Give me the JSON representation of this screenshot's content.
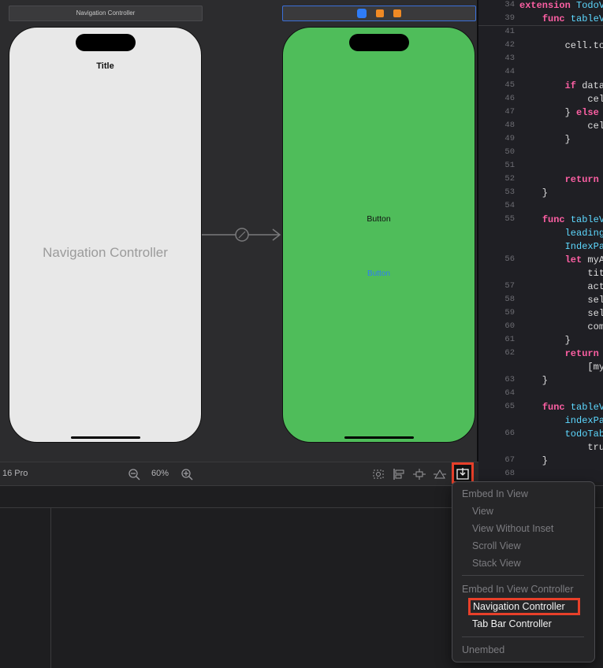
{
  "scenes": {
    "nav_scene_title": "Navigation Controller",
    "nav_phone_nav_title": "Title",
    "nav_phone_placeholder": "Navigation Controller",
    "second_phone_button_black": "Button",
    "second_phone_button_blue": "Button",
    "second_phone_bg": "#4fbd5a",
    "nav_phone_bg": "#e8e8e8"
  },
  "editor": {
    "lines": [
      {
        "n": "34",
        "text": "extension TodoV"
      },
      {
        "n": "39",
        "text": "    func tableV"
      },
      {
        "n": "41",
        "text": ""
      },
      {
        "n": "42",
        "text": "        cell.to"
      },
      {
        "n": "43",
        "text": ""
      },
      {
        "n": "44",
        "text": ""
      },
      {
        "n": "45",
        "text": "        if data"
      },
      {
        "n": "46",
        "text": "            cel"
      },
      {
        "n": "47",
        "text": "        } else"
      },
      {
        "n": "48",
        "text": "            cel"
      },
      {
        "n": "49",
        "text": "        }"
      },
      {
        "n": "50",
        "text": ""
      },
      {
        "n": "51",
        "text": ""
      },
      {
        "n": "52",
        "text": "        return"
      },
      {
        "n": "53",
        "text": "    }"
      },
      {
        "n": "54",
        "text": ""
      },
      {
        "n": "55",
        "text": "    func tableV"
      },
      {
        "n": "",
        "text": "        leading"
      },
      {
        "n": "",
        "text": "        IndexPa"
      },
      {
        "n": "56",
        "text": "        let myA"
      },
      {
        "n": "",
        "text": "            tit"
      },
      {
        "n": "57",
        "text": "            act"
      },
      {
        "n": "58",
        "text": "            sel"
      },
      {
        "n": "59",
        "text": "            sel"
      },
      {
        "n": "60",
        "text": "            com"
      },
      {
        "n": "61",
        "text": "        }"
      },
      {
        "n": "62",
        "text": "        return"
      },
      {
        "n": "",
        "text": "            [my"
      },
      {
        "n": "63",
        "text": "    }"
      },
      {
        "n": "64",
        "text": ""
      },
      {
        "n": "65",
        "text": "    func tableV"
      },
      {
        "n": "",
        "text": "        indexPa"
      },
      {
        "n": "66",
        "text": "        todoTab"
      },
      {
        "n": "",
        "text": "            tru"
      },
      {
        "n": "67",
        "text": "    }"
      },
      {
        "n": "68",
        "text": ""
      }
    ]
  },
  "toolbar": {
    "device": "16 Pro",
    "zoom": "60%"
  },
  "embed_menu": {
    "section1_header": "Embed In View",
    "view": "View",
    "view_without_inset": "View Without Inset",
    "scroll_view": "Scroll View",
    "stack_view": "Stack View",
    "section2_header": "Embed In View Controller",
    "navigation_controller": "Navigation Controller",
    "tab_bar_controller": "Tab Bar Controller",
    "unembed": "Unembed"
  },
  "colors": {
    "highlight_red": "#e8402a",
    "accent_blue": "#2f7cf6"
  }
}
